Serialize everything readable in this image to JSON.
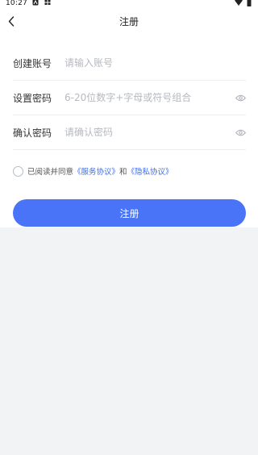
{
  "status_bar": {
    "time": "10:27",
    "icons": [
      "notification-a-icon",
      "notification-b-icon",
      "wifi-icon",
      "battery-icon"
    ]
  },
  "nav": {
    "title": "注册",
    "back_icon": "back-icon"
  },
  "form": {
    "account": {
      "label": "创建账号",
      "placeholder": "请输入账号",
      "value": ""
    },
    "password": {
      "label": "设置密码",
      "placeholder": "6-20位数字+字母或符号组合",
      "value": "",
      "toggle_icon": "eye-icon"
    },
    "confirm": {
      "label": "确认密码",
      "placeholder": "请确认密码",
      "value": "",
      "toggle_icon": "eye-icon"
    }
  },
  "agreement": {
    "checked": false,
    "prefix": "已阅读并同意",
    "service_link": "《服务协议》",
    "conjunction": "和",
    "privacy_link": "《隐私协议》"
  },
  "submit": {
    "label": "注册"
  },
  "colors": {
    "accent": "#4a74f7",
    "link": "#3d6df2",
    "background": "#f2f3f5",
    "surface": "#ffffff"
  }
}
